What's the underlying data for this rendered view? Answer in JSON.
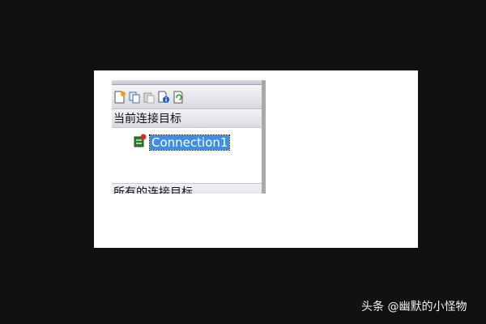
{
  "toolbar": {
    "buttons": [
      {
        "icon": "new-connection-icon"
      },
      {
        "icon": "copy-icon"
      },
      {
        "icon": "paste-icon"
      },
      {
        "icon": "properties-icon"
      },
      {
        "icon": "refresh-icon"
      }
    ]
  },
  "sections": {
    "current_label": "当前连接目标",
    "all_label": "所有的连接目标"
  },
  "tree": {
    "items": [
      {
        "label": "Connection1",
        "icon": "connection-icon",
        "selected": true
      }
    ]
  },
  "watermark": "头条 @幽默的小怪物",
  "colors": {
    "selection": "#3d8ee6",
    "page_background": "#111111"
  }
}
